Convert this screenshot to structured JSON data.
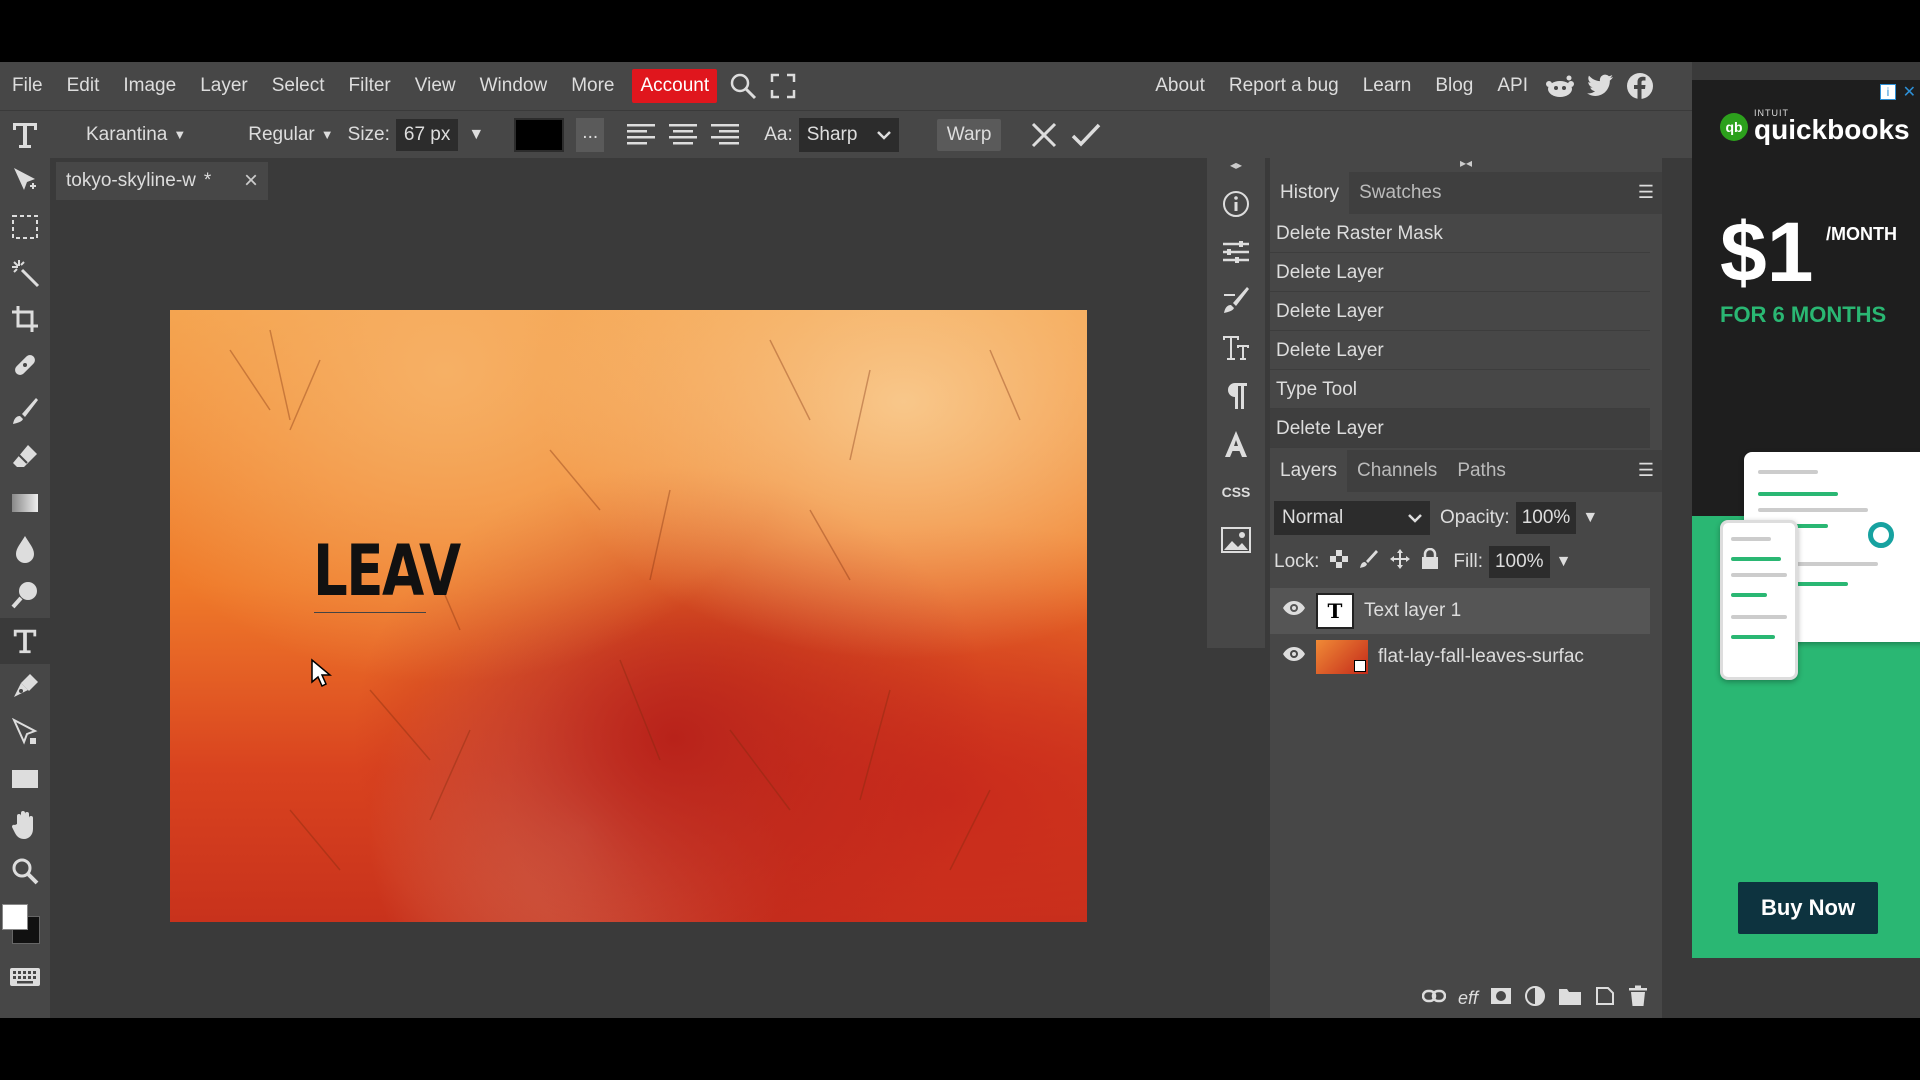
{
  "menubar": {
    "items": [
      "File",
      "Edit",
      "Image",
      "Layer",
      "Select",
      "Filter",
      "View",
      "Window",
      "More"
    ],
    "account": "Account",
    "right_items": [
      "About",
      "Report a bug",
      "Learn",
      "Blog",
      "API"
    ]
  },
  "options": {
    "font_family": "Karantina",
    "font_style": "Regular",
    "size_label": "Size:",
    "size_value": "67 px",
    "more": "...",
    "aa_label": "Aa:",
    "aa_value": "Sharp",
    "warp": "Warp",
    "text_color": "#000000"
  },
  "document": {
    "tab_title": "tokyo-skyline-w",
    "tab_modified": "*",
    "canvas_text": "LEAV"
  },
  "mini_panel": {
    "css": "CSS"
  },
  "history": {
    "tabs": [
      "History",
      "Swatches"
    ],
    "items": [
      "Delete Raster Mask",
      "Delete Layer",
      "Delete Layer",
      "Delete Layer",
      "Type Tool",
      "Delete Layer"
    ]
  },
  "layers": {
    "tabs": [
      "Layers",
      "Channels",
      "Paths"
    ],
    "blend_mode": "Normal",
    "opacity_label": "Opacity:",
    "opacity_value": "100%",
    "lock_label": "Lock:",
    "fill_label": "Fill:",
    "fill_value": "100%",
    "items": [
      {
        "name": "Text layer 1",
        "thumb": "T",
        "selected": true
      },
      {
        "name": "flat-lay-fall-leaves-surfac",
        "selected": false
      }
    ]
  },
  "ad": {
    "brand_small": "INTUIT",
    "brand": "quickbooks",
    "price": "$1",
    "per": "/MONTH",
    "offer": "FOR 6 MONTHS",
    "cta": "Buy Now",
    "brand_color": "#2ab773"
  }
}
